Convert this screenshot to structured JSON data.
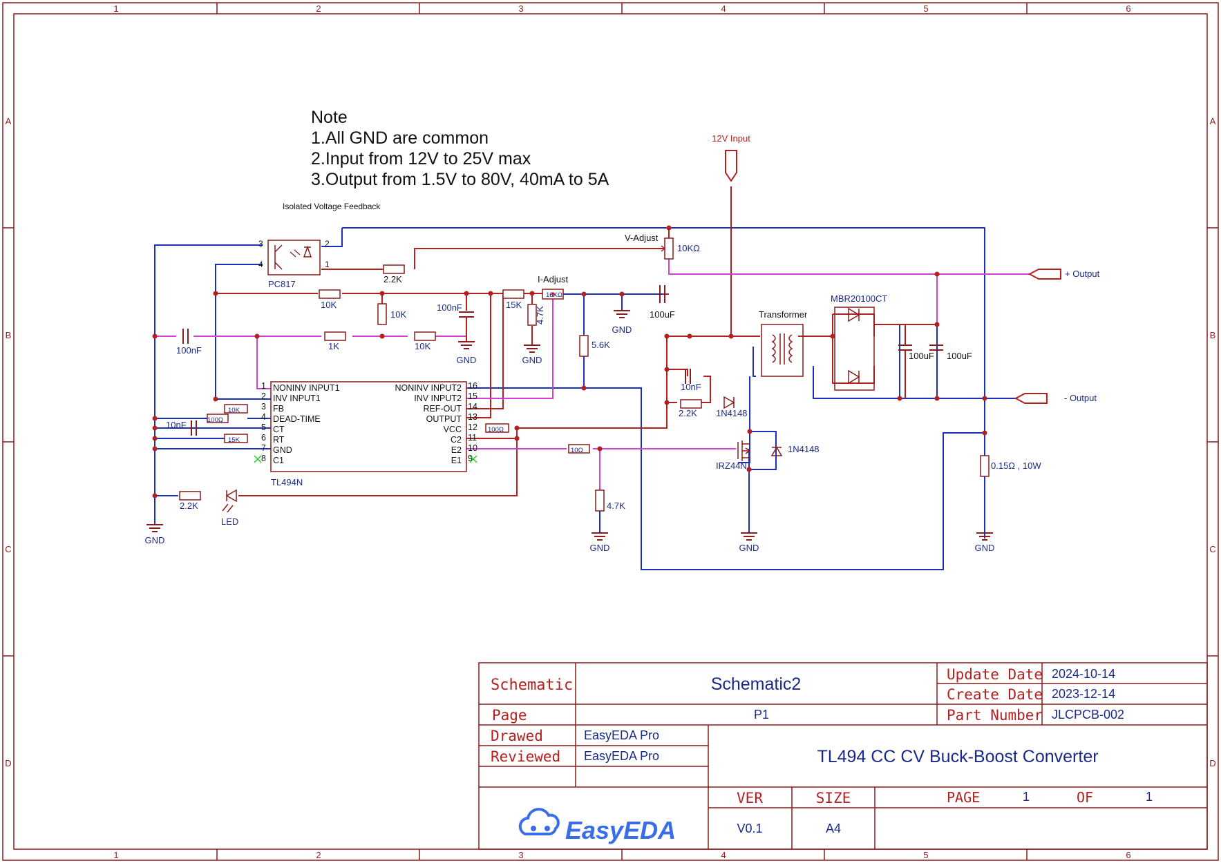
{
  "sheet": {
    "col_labels": [
      "1",
      "2",
      "3",
      "4",
      "5",
      "6"
    ],
    "row_labels": [
      "A",
      "B",
      "C",
      "D"
    ],
    "border_color": "#8b1a1a"
  },
  "colors": {
    "wire_red": "#b3201e",
    "wire_blue": "#1c2fb8",
    "wire_magenta": "#d43fd4",
    "component": "#8b1a1a",
    "text_blue": "#1a2a8a",
    "noconnect": "#22cc22"
  },
  "note": {
    "title": "Note",
    "lines": [
      "1.All GND are common",
      "2.Input from 12V to 25V max",
      "3.Output from 1.5V to 80V, 40mA to 5A"
    ]
  },
  "ports": {
    "input": "12V Input",
    "out_plus": "+ Output",
    "out_minus": "- Output"
  },
  "ic": {
    "name": "TL494N",
    "left_pins": [
      {
        "num": "1",
        "name": "NONINV INPUT1"
      },
      {
        "num": "2",
        "name": "INV INPUT1"
      },
      {
        "num": "3",
        "name": "FB"
      },
      {
        "num": "4",
        "name": "DEAD-TIME"
      },
      {
        "num": "5",
        "name": "CT"
      },
      {
        "num": "6",
        "name": "RT"
      },
      {
        "num": "7",
        "name": "GND"
      },
      {
        "num": "8",
        "name": "C1"
      }
    ],
    "right_pins": [
      {
        "num": "16",
        "name": "NONINV INPUT2"
      },
      {
        "num": "15",
        "name": "INV INPUT2"
      },
      {
        "num": "14",
        "name": "REF-OUT"
      },
      {
        "num": "13",
        "name": "OUTPUT"
      },
      {
        "num": "12",
        "name": "VCC"
      },
      {
        "num": "11",
        "name": "C2"
      },
      {
        "num": "10",
        "name": "E2"
      },
      {
        "num": "9",
        "name": "E1"
      }
    ]
  },
  "labels": {
    "iso_feedback": "Isolated Voltage Feedback",
    "pc817": "PC817",
    "opto_pins": [
      "3",
      "4",
      "2",
      "1"
    ],
    "r_2k2_opto": "2.2K",
    "v_adjust": "V-Adjust",
    "r_10kohm_pot": "10KΩ",
    "i_adjust": "I-Adjust",
    "r_10k_a": "10K",
    "r_10k_b": "10K",
    "r_10k_c": "10K",
    "c_100nf_a": "100nF",
    "c_100nf_b": "100nF",
    "r_1k": "1K",
    "r_15k": "15K",
    "r_10kohm_iadj": "10KΩ",
    "r_4k7_a": "4.7K",
    "r_5k6": "5.6K",
    "c_100uf_a": "100uF",
    "gnd": "GND",
    "transformer": "Transformer",
    "mbr": "MBR20100CT",
    "c_100uf_b": "100uF",
    "c_100uf_c": "100uF",
    "r_10k_fb": "10K",
    "r_100ohm_a": "100Ω",
    "c_10nf_a": "10nF",
    "r_15k_rt": "15K",
    "r_100ohm_b": "100Ω",
    "c_10nf_b": "10nF",
    "r_2k2_b": "2.2K",
    "d_1n4148_a": "1N4148",
    "r_10ohm": "10Ω",
    "d_1n4148_b": "1N4148",
    "mosfet": "IRZ44N",
    "r_shunt": "0.15Ω , 10W",
    "r_4k7_b": "4.7K",
    "r_2k2_led": "2.2K",
    "led": "LED"
  },
  "title_block": {
    "schematic_label": "Schematic",
    "schematic_value": "Schematic2",
    "update_label": "Update Date",
    "update_value": "2024-10-14",
    "create_label": "Create Date",
    "create_value": "2023-12-14",
    "page_label": "Page",
    "page_value": "P1",
    "part_label": "Part Number",
    "part_value": "JLCPCB-002",
    "drawed_label": "Drawed",
    "drawed_value": "EasyEDA Pro",
    "reviewed_label": "Reviewed",
    "reviewed_value": "EasyEDA Pro",
    "project_title": "TL494 CC CV Buck-Boost Converter",
    "ver_label": "VER",
    "ver_value": "V0.1",
    "size_label": "SIZE",
    "size_value": "A4",
    "page_of_label": "PAGE",
    "page_num": "1",
    "of_label": "OF",
    "page_total": "1",
    "logo_text": "EasyEDA"
  }
}
